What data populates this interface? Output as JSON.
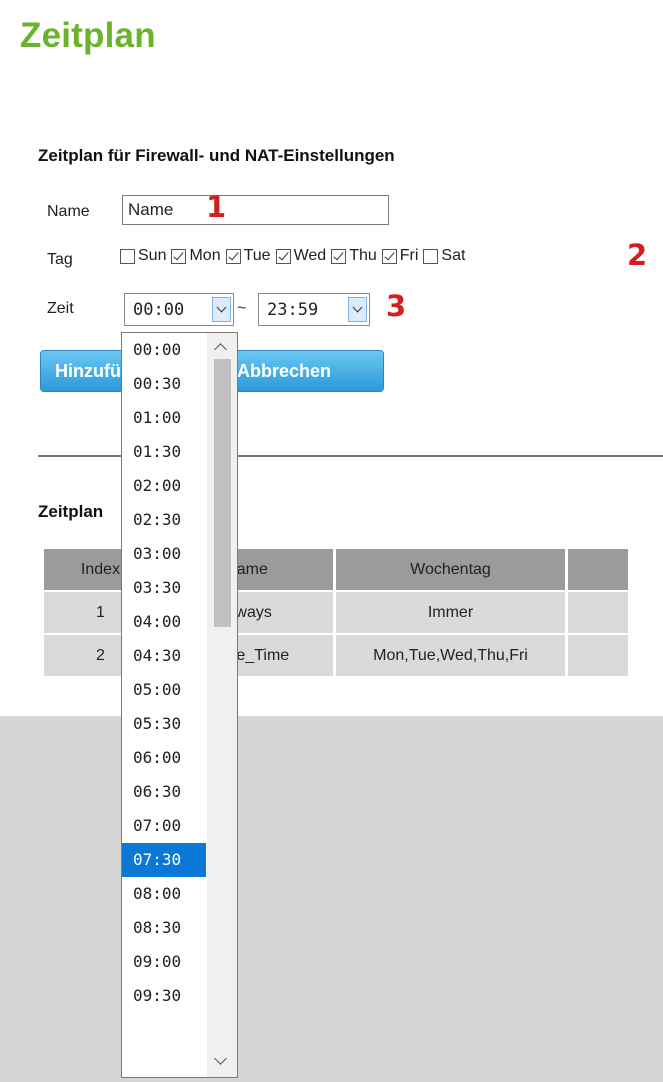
{
  "page": {
    "title": "Zeitplan"
  },
  "form": {
    "section_title": "Zeitplan für Firewall- und NAT-Einstellungen",
    "name_label": "Name",
    "name_value": "Name",
    "tag_label": "Tag",
    "zeit_label": "Zeit",
    "days": [
      {
        "label": "Sun",
        "checked": false
      },
      {
        "label": "Mon",
        "checked": true
      },
      {
        "label": "Tue",
        "checked": true
      },
      {
        "label": "Wed",
        "checked": true
      },
      {
        "label": "Thu",
        "checked": true
      },
      {
        "label": "Fri",
        "checked": true
      },
      {
        "label": "Sat",
        "checked": false
      }
    ],
    "time_from": "00:00",
    "time_separator": "~",
    "time_to": "23:59",
    "add_button": "Hinzufügen",
    "cancel_button": "Abbrechen"
  },
  "annotations": {
    "n1": "1",
    "n2": "2",
    "n3": "3"
  },
  "schedule_list": {
    "title": "Zeitplan",
    "columns": [
      "Index",
      "Name",
      "Wochentag",
      ""
    ],
    "rows": [
      {
        "index": "1",
        "name": "Always",
        "weekday": "Immer"
      },
      {
        "index": "2",
        "name": "Office_Time",
        "weekday": "Mon,Tue,Wed,Thu,Fri"
      }
    ]
  },
  "time_dropdown": {
    "options": [
      "00:00",
      "00:30",
      "01:00",
      "01:30",
      "02:00",
      "02:30",
      "03:00",
      "03:30",
      "04:00",
      "04:30",
      "05:00",
      "05:30",
      "06:00",
      "06:30",
      "07:00",
      "07:30",
      "08:00",
      "08:30",
      "09:00",
      "09:30"
    ],
    "highlighted": "07:30"
  },
  "colors": {
    "title_green": "#6ab42a",
    "highlight_blue": "#0b78d7",
    "annotation_red": "#d02020"
  }
}
